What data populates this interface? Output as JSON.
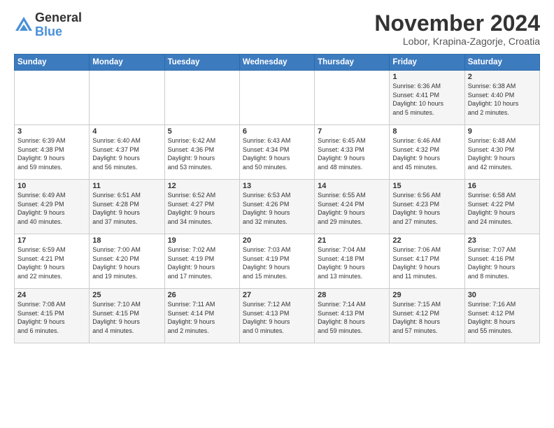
{
  "logo": {
    "general": "General",
    "blue": "Blue"
  },
  "title": "November 2024",
  "location": "Lobor, Krapina-Zagorje, Croatia",
  "headers": [
    "Sunday",
    "Monday",
    "Tuesday",
    "Wednesday",
    "Thursday",
    "Friday",
    "Saturday"
  ],
  "weeks": [
    [
      {
        "day": "",
        "info": ""
      },
      {
        "day": "",
        "info": ""
      },
      {
        "day": "",
        "info": ""
      },
      {
        "day": "",
        "info": ""
      },
      {
        "day": "",
        "info": ""
      },
      {
        "day": "1",
        "info": "Sunrise: 6:36 AM\nSunset: 4:41 PM\nDaylight: 10 hours\nand 5 minutes."
      },
      {
        "day": "2",
        "info": "Sunrise: 6:38 AM\nSunset: 4:40 PM\nDaylight: 10 hours\nand 2 minutes."
      }
    ],
    [
      {
        "day": "3",
        "info": "Sunrise: 6:39 AM\nSunset: 4:38 PM\nDaylight: 9 hours\nand 59 minutes."
      },
      {
        "day": "4",
        "info": "Sunrise: 6:40 AM\nSunset: 4:37 PM\nDaylight: 9 hours\nand 56 minutes."
      },
      {
        "day": "5",
        "info": "Sunrise: 6:42 AM\nSunset: 4:36 PM\nDaylight: 9 hours\nand 53 minutes."
      },
      {
        "day": "6",
        "info": "Sunrise: 6:43 AM\nSunset: 4:34 PM\nDaylight: 9 hours\nand 50 minutes."
      },
      {
        "day": "7",
        "info": "Sunrise: 6:45 AM\nSunset: 4:33 PM\nDaylight: 9 hours\nand 48 minutes."
      },
      {
        "day": "8",
        "info": "Sunrise: 6:46 AM\nSunset: 4:32 PM\nDaylight: 9 hours\nand 45 minutes."
      },
      {
        "day": "9",
        "info": "Sunrise: 6:48 AM\nSunset: 4:30 PM\nDaylight: 9 hours\nand 42 minutes."
      }
    ],
    [
      {
        "day": "10",
        "info": "Sunrise: 6:49 AM\nSunset: 4:29 PM\nDaylight: 9 hours\nand 40 minutes."
      },
      {
        "day": "11",
        "info": "Sunrise: 6:51 AM\nSunset: 4:28 PM\nDaylight: 9 hours\nand 37 minutes."
      },
      {
        "day": "12",
        "info": "Sunrise: 6:52 AM\nSunset: 4:27 PM\nDaylight: 9 hours\nand 34 minutes."
      },
      {
        "day": "13",
        "info": "Sunrise: 6:53 AM\nSunset: 4:26 PM\nDaylight: 9 hours\nand 32 minutes."
      },
      {
        "day": "14",
        "info": "Sunrise: 6:55 AM\nSunset: 4:24 PM\nDaylight: 9 hours\nand 29 minutes."
      },
      {
        "day": "15",
        "info": "Sunrise: 6:56 AM\nSunset: 4:23 PM\nDaylight: 9 hours\nand 27 minutes."
      },
      {
        "day": "16",
        "info": "Sunrise: 6:58 AM\nSunset: 4:22 PM\nDaylight: 9 hours\nand 24 minutes."
      }
    ],
    [
      {
        "day": "17",
        "info": "Sunrise: 6:59 AM\nSunset: 4:21 PM\nDaylight: 9 hours\nand 22 minutes."
      },
      {
        "day": "18",
        "info": "Sunrise: 7:00 AM\nSunset: 4:20 PM\nDaylight: 9 hours\nand 19 minutes."
      },
      {
        "day": "19",
        "info": "Sunrise: 7:02 AM\nSunset: 4:19 PM\nDaylight: 9 hours\nand 17 minutes."
      },
      {
        "day": "20",
        "info": "Sunrise: 7:03 AM\nSunset: 4:19 PM\nDaylight: 9 hours\nand 15 minutes."
      },
      {
        "day": "21",
        "info": "Sunrise: 7:04 AM\nSunset: 4:18 PM\nDaylight: 9 hours\nand 13 minutes."
      },
      {
        "day": "22",
        "info": "Sunrise: 7:06 AM\nSunset: 4:17 PM\nDaylight: 9 hours\nand 11 minutes."
      },
      {
        "day": "23",
        "info": "Sunrise: 7:07 AM\nSunset: 4:16 PM\nDaylight: 9 hours\nand 8 minutes."
      }
    ],
    [
      {
        "day": "24",
        "info": "Sunrise: 7:08 AM\nSunset: 4:15 PM\nDaylight: 9 hours\nand 6 minutes."
      },
      {
        "day": "25",
        "info": "Sunrise: 7:10 AM\nSunset: 4:15 PM\nDaylight: 9 hours\nand 4 minutes."
      },
      {
        "day": "26",
        "info": "Sunrise: 7:11 AM\nSunset: 4:14 PM\nDaylight: 9 hours\nand 2 minutes."
      },
      {
        "day": "27",
        "info": "Sunrise: 7:12 AM\nSunset: 4:13 PM\nDaylight: 9 hours\nand 0 minutes."
      },
      {
        "day": "28",
        "info": "Sunrise: 7:14 AM\nSunset: 4:13 PM\nDaylight: 8 hours\nand 59 minutes."
      },
      {
        "day": "29",
        "info": "Sunrise: 7:15 AM\nSunset: 4:12 PM\nDaylight: 8 hours\nand 57 minutes."
      },
      {
        "day": "30",
        "info": "Sunrise: 7:16 AM\nSunset: 4:12 PM\nDaylight: 8 hours\nand 55 minutes."
      }
    ]
  ]
}
